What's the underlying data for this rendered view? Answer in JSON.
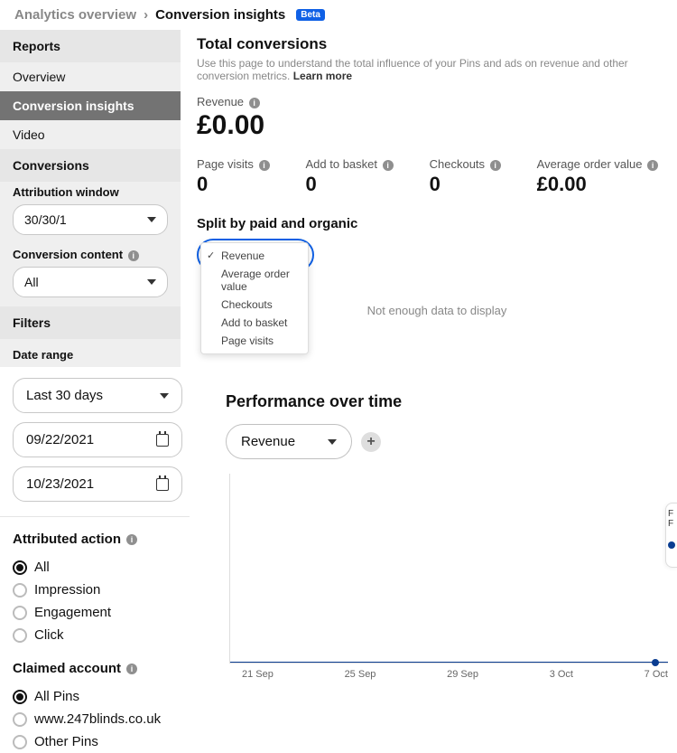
{
  "breadcrumb": {
    "parent": "Analytics overview",
    "current": "Conversion insights",
    "badge": "Beta"
  },
  "sidebar": {
    "sections": {
      "reports_header": "Reports",
      "reports_items": [
        "Overview",
        "Conversion insights",
        "Video"
      ],
      "conversions_header": "Conversions",
      "attribution_label": "Attribution window",
      "attribution_value": "30/30/1",
      "content_label": "Conversion content",
      "content_value": "All",
      "filters_header": "Filters",
      "date_range_label": "Date range"
    }
  },
  "main": {
    "title": "Total conversions",
    "subtext": "Use this page to understand the total influence of your Pins and ads on revenue and other conversion metrics.",
    "learn_more": "Learn more",
    "revenue_label": "Revenue",
    "revenue_value": "£0.00",
    "metrics": [
      {
        "label": "Page visits",
        "value": "0"
      },
      {
        "label": "Add to basket",
        "value": "0"
      },
      {
        "label": "Checkouts",
        "value": "0"
      },
      {
        "label": "Average order value",
        "value": "£0.00"
      }
    ],
    "split_title": "Split by paid and organic",
    "split_options": [
      "Revenue",
      "Average order value",
      "Checkouts",
      "Add to basket",
      "Page visits"
    ],
    "split_selected": "Revenue",
    "nodata": "Not enough data to display"
  },
  "date": {
    "range_preset": "Last 30 days",
    "start": "09/22/2021",
    "end": "10/23/2021"
  },
  "filters": {
    "attributed_label": "Attributed action",
    "attributed_options": [
      "All",
      "Impression",
      "Engagement",
      "Click"
    ],
    "attributed_selected": "All",
    "claimed_label": "Claimed account",
    "claimed_options": [
      "All Pins",
      "www.247blinds.co.uk",
      "Other Pins"
    ],
    "claimed_selected": "All Pins"
  },
  "performance": {
    "title": "Performance over time",
    "select_value": "Revenue"
  },
  "chart_data": {
    "type": "line",
    "title": "Performance over time",
    "xlabel": "",
    "ylabel": "Revenue",
    "categories": [
      "21 Sep",
      "25 Sep",
      "29 Sep",
      "3 Oct",
      "7 Oct"
    ],
    "series": [
      {
        "name": "Revenue",
        "values": [
          0,
          0,
          0,
          0,
          0
        ]
      }
    ],
    "ylim": [
      0,
      1
    ]
  }
}
